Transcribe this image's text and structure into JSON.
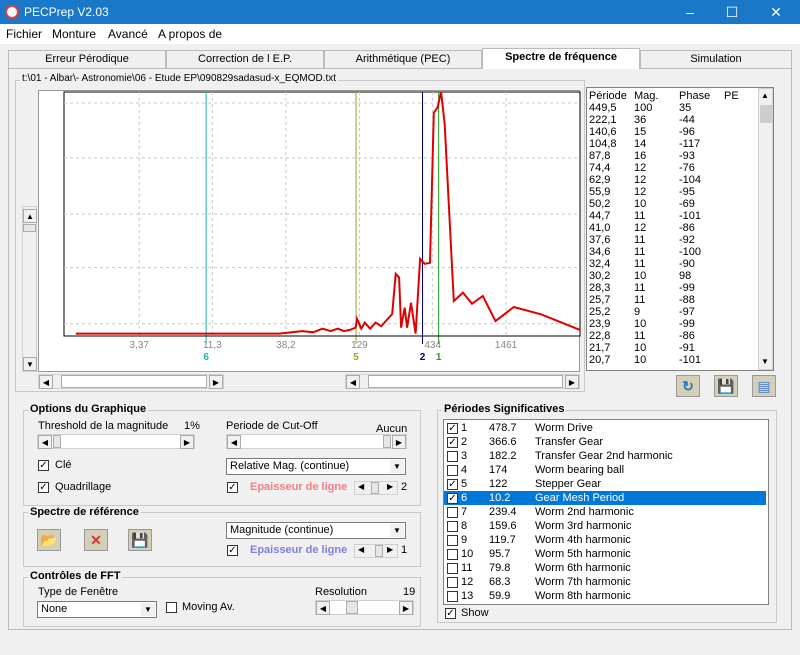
{
  "window": {
    "title": "PECPrep V2.03",
    "minimize": "–",
    "maximize": "☐",
    "close": "✕"
  },
  "menu": [
    "Fichier",
    "Monture",
    "Avancé",
    "A propos de"
  ],
  "tabs": [
    {
      "label": "Erreur Pérodique",
      "active": false
    },
    {
      "label": "Correction de l E.P.",
      "active": false
    },
    {
      "label": "Arithmétique (PEC)",
      "active": false
    },
    {
      "label": "Spectre de fréquence",
      "active": true
    },
    {
      "label": "Simulation",
      "active": false
    }
  ],
  "file_path": "t:\\01 - Albar\\- Astronomie\\06 - Etude EP\\090829sadasud-x_EQMOD.txt",
  "chart_data": {
    "type": "line",
    "title": "",
    "xlabel": "Période",
    "ylabel": "Magnitude",
    "x_scale": "log",
    "xlim": [
      0.97,
      4970
    ],
    "ylim": [
      0,
      100
    ],
    "x_ticks": [
      {
        "value": 3.37,
        "label": "3,37"
      },
      {
        "value": 11.3,
        "label": "11,3"
      },
      {
        "value": 38.2,
        "label": "38,2"
      },
      {
        "value": 129,
        "label": "129"
      },
      {
        "value": 434,
        "label": "434"
      },
      {
        "value": 1461,
        "label": "1461"
      }
    ],
    "grid": true,
    "series": [
      {
        "name": "Relative Mag.",
        "color": "#e00000",
        "points": [
          [
            1.18,
            1
          ],
          [
            34.2,
            1
          ],
          [
            50,
            2
          ],
          [
            60,
            1.5
          ],
          [
            70,
            3
          ],
          [
            80,
            2
          ],
          [
            90,
            3
          ],
          [
            100,
            2
          ],
          [
            110,
            2.5
          ],
          [
            121,
            3.4
          ],
          [
            124,
            7
          ],
          [
            133,
            3
          ],
          [
            141,
            5.5
          ],
          [
            154,
            3
          ],
          [
            169,
            5.5
          ],
          [
            185,
            4
          ],
          [
            222,
            9
          ],
          [
            235,
            25.5
          ],
          [
            249,
            24
          ],
          [
            257,
            3.4
          ],
          [
            273,
            11.6
          ],
          [
            284,
            3.4
          ],
          [
            303,
            13.6
          ],
          [
            327,
            1
          ],
          [
            352,
            31.6
          ],
          [
            380,
            29.6
          ],
          [
            415,
            30
          ],
          [
            442,
            91.5
          ],
          [
            470,
            93.6
          ],
          [
            499,
            100
          ],
          [
            529,
            86.7
          ],
          [
            615,
            14.3
          ],
          [
            715,
            17.8
          ],
          [
            832,
            13.2
          ],
          [
            995,
            16.4
          ],
          [
            1228,
            6.1
          ],
          [
            1660,
            11.9
          ],
          [
            2606,
            8.9
          ],
          [
            4966,
            2.5
          ]
        ]
      }
    ],
    "markers": [
      {
        "label": "6",
        "period": 10.2,
        "color": "#20b0b0"
      },
      {
        "label": "5",
        "period": 122,
        "color": "#a0a020"
      },
      {
        "label": "2",
        "period": 366.6,
        "color": "#000080"
      },
      {
        "label": "1",
        "period": 478.7,
        "color": "#20a020"
      }
    ]
  },
  "period_table": {
    "headers": [
      "Période",
      "Mag.",
      "Phase",
      "PE"
    ],
    "rows": [
      [
        "449,5",
        "100",
        "35"
      ],
      [
        "222,1",
        "36",
        "-44"
      ],
      [
        "140,6",
        "15",
        "-96"
      ],
      [
        "104,8",
        "14",
        "-117"
      ],
      [
        "87,8",
        "16",
        "-93"
      ],
      [
        "74,4",
        "12",
        "-76"
      ],
      [
        "62,9",
        "12",
        "-104"
      ],
      [
        "55,9",
        "12",
        "-95"
      ],
      [
        "50,2",
        "10",
        "-69"
      ],
      [
        "44,7",
        "11",
        "-101"
      ],
      [
        "41,0",
        "12",
        "-86"
      ],
      [
        "37,6",
        "11",
        "-92"
      ],
      [
        "34,6",
        "11",
        "-100"
      ],
      [
        "32,4",
        "11",
        "-90"
      ],
      [
        "30,2",
        "10",
        "98"
      ],
      [
        "28,3",
        "11",
        "-99"
      ],
      [
        "25,7",
        "11",
        "-88"
      ],
      [
        "25,2",
        "9",
        "-97"
      ],
      [
        "23,9",
        "10",
        "-99"
      ],
      [
        "22,8",
        "11",
        "-86"
      ],
      [
        "21,7",
        "10",
        "-91"
      ],
      [
        "20,7",
        "10",
        "-101"
      ]
    ]
  },
  "options": {
    "title": "Options du Graphique",
    "threshold_label": "Threshold de la magnitude",
    "threshold_value": "1%",
    "cutoff_label": "Periode de Cut-Off",
    "cutoff_value": "Aucun",
    "cle_label": "Clé",
    "grid_label": "Quadrillage",
    "mode_select": "Relative Mag. (continue)",
    "line_width_label": "Epaisseur de ligne",
    "line_width_value": "2",
    "line_color": "#f08080"
  },
  "reference": {
    "title": "Spectre de référence",
    "mode_select": "Magnitude (continue)",
    "line_width_label": "Epaisseur de ligne",
    "line_width_value": "1",
    "line_color": "#8080e0"
  },
  "fft": {
    "title": "Contrôles de FFT",
    "window_label": "Type de Fenêtre",
    "window_value": "None",
    "moving_avg_label": "Moving Av.",
    "resolution_label": "Resolution",
    "resolution_value": "19"
  },
  "significant": {
    "title": "Périodes Significatives",
    "show_label": "Show",
    "rows": [
      {
        "n": "1",
        "period": "478.7",
        "name": "Worm Drive",
        "checked": true
      },
      {
        "n": "2",
        "period": "366.6",
        "name": "Transfer Gear",
        "checked": true
      },
      {
        "n": "3",
        "period": "182.2",
        "name": "Transfer Gear 2nd harmonic",
        "checked": false
      },
      {
        "n": "4",
        "period": "174",
        "name": "Worm bearing ball",
        "checked": false
      },
      {
        "n": "5",
        "period": "122",
        "name": "Stepper Gear",
        "checked": true
      },
      {
        "n": "6",
        "period": "10.2",
        "name": "Gear Mesh Period",
        "checked": true,
        "selected": true
      },
      {
        "n": "7",
        "period": "239.4",
        "name": "Worm 2nd harmonic",
        "checked": false
      },
      {
        "n": "8",
        "period": "159.6",
        "name": "Worm 3rd harmonic",
        "checked": false
      },
      {
        "n": "9",
        "period": "119.7",
        "name": "Worm 4th harmonic",
        "checked": false
      },
      {
        "n": "10",
        "period": "95.7",
        "name": "Worm 5th harmonic",
        "checked": false
      },
      {
        "n": "11",
        "period": "79.8",
        "name": "Worm 6th harmonic",
        "checked": false
      },
      {
        "n": "12",
        "period": "68.3",
        "name": "Worm 7th harmonic",
        "checked": false
      },
      {
        "n": "13",
        "period": "59.9",
        "name": "Worm 8th harmonic",
        "checked": false
      }
    ]
  }
}
